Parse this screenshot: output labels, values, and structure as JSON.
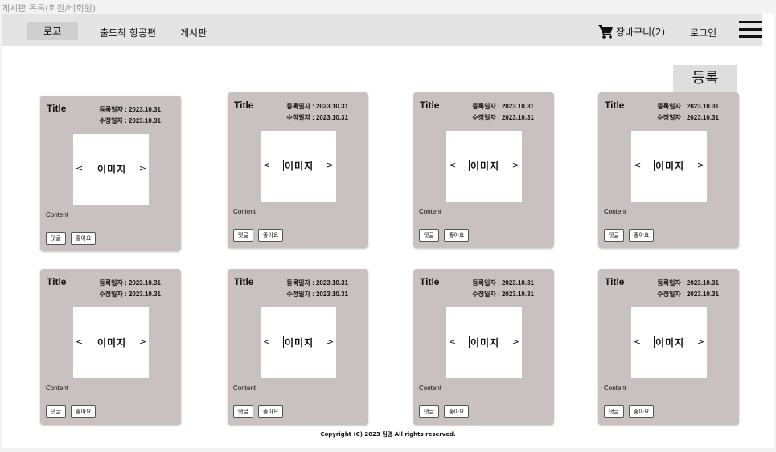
{
  "frame_title": "게시판 목록(회원/비회원)",
  "nav": {
    "logo": "로고",
    "link_flights": "출도착 항공편",
    "link_board": "게시판",
    "cart_icon": "shopping-cart-icon",
    "cart_label": "장바구니(2)",
    "login": "로그인",
    "menu_icon": "hamburger-menu-icon"
  },
  "register_button": "등록",
  "cards": [
    {
      "title": "Title",
      "created": "등록일자 : 2023.10.31",
      "modified": "수정일자 : 2023.10.31",
      "image_label": "이미지",
      "prev": "<",
      "next": ">",
      "content": "Content",
      "comment_button": "댓글",
      "like_button": "좋아요"
    },
    {
      "title": "Title",
      "created": "등록일자 : 2023.10.31",
      "modified": "수정일자 : 2023.10.31",
      "image_label": "이미지",
      "prev": "<",
      "next": ">",
      "content": "Content",
      "comment_button": "댓글",
      "like_button": "좋아요"
    },
    {
      "title": "Title",
      "created": "등록일자 : 2023.10.31",
      "modified": "수정일자 : 2023.10.31",
      "image_label": "이미지",
      "prev": "<",
      "next": ">",
      "content": "Content",
      "comment_button": "댓글",
      "like_button": "좋아요"
    },
    {
      "title": "Title",
      "created": "등록일자 : 2023.10.31",
      "modified": "수정일자 : 2023.10.31",
      "image_label": "이미지",
      "prev": "<",
      "next": ">",
      "content": "Content",
      "comment_button": "댓글",
      "like_button": "좋아요"
    },
    {
      "title": "Title",
      "created": "등록일자 : 2023.10.31",
      "modified": "수정일자 : 2023.10.31",
      "image_label": "이미지",
      "prev": "<",
      "next": ">",
      "content": "Content",
      "comment_button": "댓글",
      "like_button": "좋아요"
    },
    {
      "title": "Title",
      "created": "등록일자 : 2023.10.31",
      "modified": "수정일자 : 2023.10.31",
      "image_label": "이미지",
      "prev": "<",
      "next": ">",
      "content": "Content",
      "comment_button": "댓글",
      "like_button": "좋아요"
    },
    {
      "title": "Title",
      "created": "등록일자 : 2023.10.31",
      "modified": "수정일자 : 2023.10.31",
      "image_label": "이미지",
      "prev": "<",
      "next": ">",
      "content": "Content",
      "comment_button": "댓글",
      "like_button": "좋아요"
    },
    {
      "title": "Title",
      "created": "등록일자 : 2023.10.31",
      "modified": "수정일자 : 2023.10.31",
      "image_label": "이미지",
      "prev": "<",
      "next": ">",
      "content": "Content",
      "comment_button": "댓글",
      "like_button": "좋아요"
    }
  ],
  "footer": "Copyright (C) 2023 팀명 All rights reserved.",
  "colors": {
    "navbar_bg": "#e4e4e4",
    "card_bg": "#c8c1c0",
    "register_bg": "#dedede"
  }
}
